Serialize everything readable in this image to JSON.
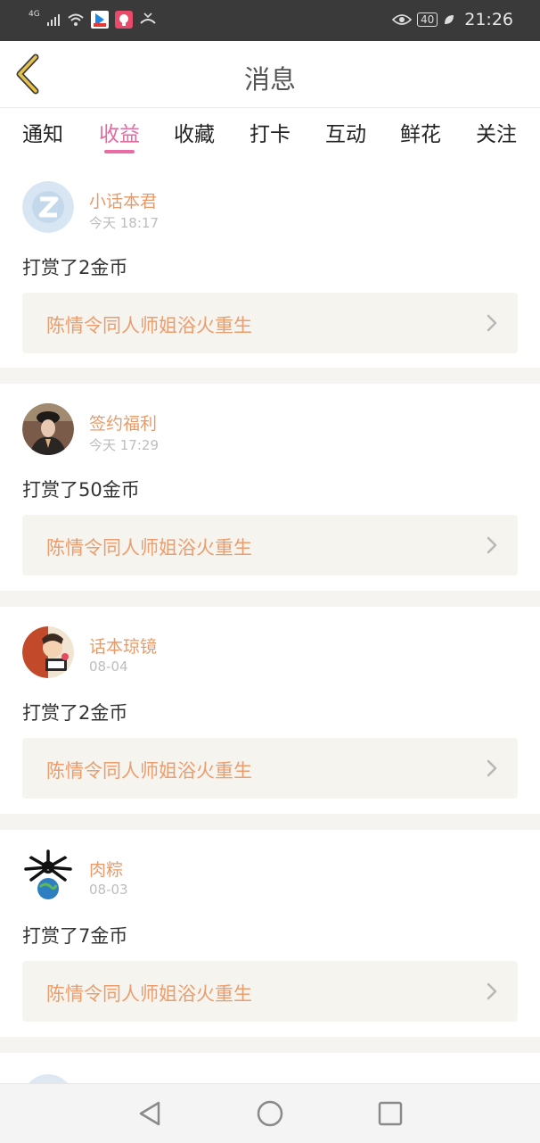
{
  "status_bar": {
    "network": "4G",
    "battery": "40",
    "time": "21:26"
  },
  "header": {
    "title": "消息",
    "back_icon": "chevron-left-icon"
  },
  "tabs": [
    {
      "label": "通知",
      "active": false
    },
    {
      "label": "收益",
      "active": true
    },
    {
      "label": "收藏",
      "active": false
    },
    {
      "label": "打卡",
      "active": false
    },
    {
      "label": "互动",
      "active": false
    },
    {
      "label": "鲜花",
      "active": false
    },
    {
      "label": "关注",
      "active": false
    }
  ],
  "messages": [
    {
      "user": "小话本君",
      "time": "今天 18:17",
      "text": "打赏了2金币",
      "book": "陈情令同人师姐浴火重生"
    },
    {
      "user": "签约福利",
      "time": "今天 17:29",
      "text": "打赏了50金币",
      "book": "陈情令同人师姐浴火重生"
    },
    {
      "user": "话本琼镜",
      "time": "08-04",
      "text": "打赏了2金币",
      "book": "陈情令同人师姐浴火重生"
    },
    {
      "user": "肉粽",
      "time": "08-03",
      "text": "打赏了7金币",
      "book": "陈情令同人师姐浴火重生"
    }
  ],
  "colors": {
    "accent": "#e26ba0",
    "username": "#e89b6a",
    "book_title": "#ec9d6e",
    "back_icon": "#c9a227"
  }
}
